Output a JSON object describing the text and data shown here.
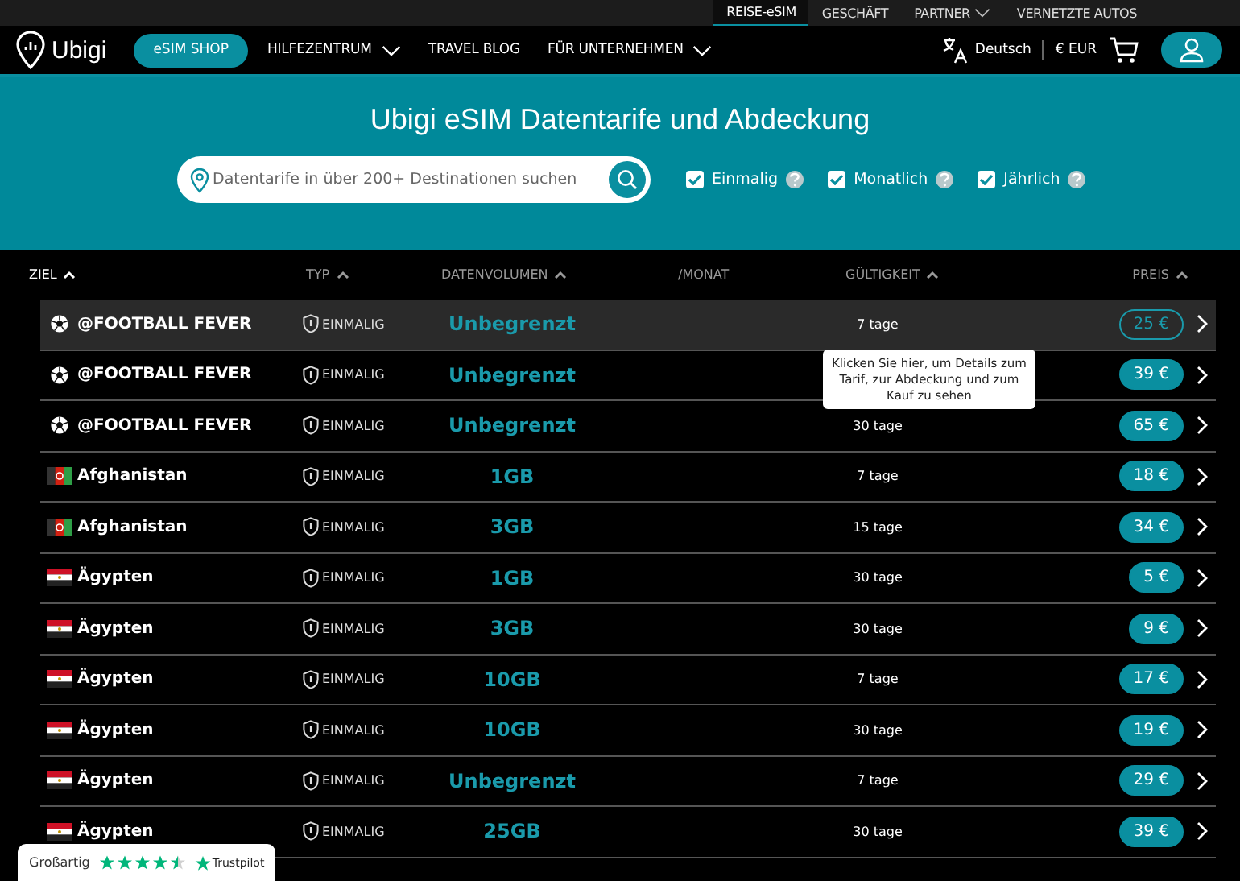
{
  "top_bar": {
    "links": [
      {
        "label": "REISE-eSIM",
        "selected": true,
        "dropdown": false
      },
      {
        "label": "GESCHÄFT",
        "selected": false,
        "dropdown": false
      },
      {
        "label": "PARTNER",
        "selected": false,
        "dropdown": true
      },
      {
        "label": "VERNETZTE AUTOS",
        "selected": false,
        "dropdown": false
      }
    ]
  },
  "nav": {
    "logo": "Ubigi",
    "shop_button": "eSIM SHOP",
    "links": [
      {
        "label": "HILFEZENTRUM",
        "dropdown": true
      },
      {
        "label": "TRAVEL BLOG",
        "dropdown": false
      },
      {
        "label": "FÜR UNTERNEHMEN",
        "dropdown": true
      }
    ],
    "language": "Deutsch",
    "currency": "€ EUR"
  },
  "hero": {
    "title": "Ubigi eSIM Datentarife und Abdeckung",
    "search": {
      "placeholder": "Datentarife in über 200+ Destinationen suchen"
    },
    "filters": [
      {
        "label": "Einmalig",
        "checked": true
      },
      {
        "label": "Monatlich",
        "checked": true
      },
      {
        "label": "Jährlich",
        "checked": true
      }
    ]
  },
  "table": {
    "columns": [
      {
        "label": "ZIEL",
        "sortable": true
      },
      {
        "label": "TYP",
        "sortable": true
      },
      {
        "label": "DATENVOLUMEN",
        "sortable": true
      },
      {
        "label": "/MONAT",
        "sortable": false
      },
      {
        "label": "GÜLTIGKEIT",
        "sortable": true
      },
      {
        "label": "PREIS",
        "sortable": true
      }
    ],
    "rows": [
      {
        "kind": "ball",
        "name": "@FOOTBALL FEVER",
        "type": "EINMALIG",
        "volume": "Unbegrenzt",
        "validity": "7 tage",
        "price": "25 €",
        "hovered": true
      },
      {
        "kind": "ball",
        "name": "@FOOTBALL FEVER",
        "type": "EINMALIG",
        "volume": "Unbegrenzt",
        "price": "39 €",
        "hovered": false
      },
      {
        "kind": "ball",
        "name": "@FOOTBALL FEVER",
        "type": "EINMALIG",
        "volume": "Unbegrenzt",
        "validity": "30 tage",
        "price": "65 €",
        "hovered": false
      },
      {
        "kind": "af",
        "name": "Afghanistan",
        "type": "EINMALIG",
        "volume": "1GB",
        "validity": "7 tage",
        "price": "18 €",
        "hovered": false
      },
      {
        "kind": "af",
        "name": "Afghanistan",
        "type": "EINMALIG",
        "volume": "3GB",
        "validity": "15 tage",
        "price": "34 €",
        "hovered": false
      },
      {
        "kind": "eg",
        "name": "Ägypten",
        "type": "EINMALIG",
        "volume": "1GB",
        "validity": "30 tage",
        "price": "5 €",
        "hovered": false
      },
      {
        "kind": "eg",
        "name": "Ägypten",
        "type": "EINMALIG",
        "volume": "3GB",
        "validity": "30 tage",
        "price": "9 €",
        "hovered": false
      },
      {
        "kind": "eg",
        "name": "Ägypten",
        "type": "EINMALIG",
        "volume": "10GB",
        "validity": "7 tage",
        "price": "17 €",
        "hovered": false
      },
      {
        "kind": "eg",
        "name": "Ägypten",
        "type": "EINMALIG",
        "volume": "10GB",
        "validity": "30 tage",
        "price": "19 €",
        "hovered": false
      },
      {
        "kind": "eg",
        "name": "Ägypten",
        "type": "EINMALIG",
        "volume": "Unbegrenzt",
        "validity": "7 tage",
        "price": "29 €",
        "hovered": false
      },
      {
        "kind": "eg",
        "name": "Ägypten",
        "type": "EINMALIG",
        "volume": "25GB",
        "validity": "30 tage",
        "price": "39 €",
        "hovered": false
      }
    ],
    "tooltip": "Klicken Sie hier, um Details zum Tarif, zur Abdeckung und zum Kauf zu sehen"
  },
  "rating_widget": {
    "label": "Großartig",
    "stars": 4.5,
    "brand": "Trustpilot"
  }
}
